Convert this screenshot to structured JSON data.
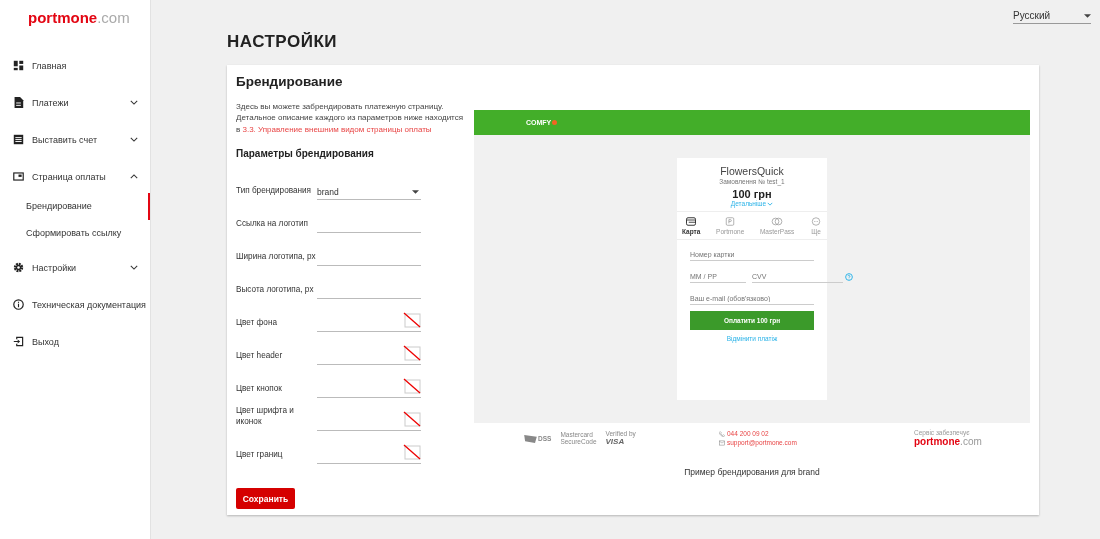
{
  "logo": {
    "brand": "portmone",
    "suffix": ".com"
  },
  "sidebar": {
    "items": [
      {
        "kind": "dashboard",
        "label": "Главная"
      },
      {
        "kind": "document",
        "label": "Платежи",
        "expanded": false
      },
      {
        "kind": "list",
        "label": "Выставить счет",
        "expanded": false
      },
      {
        "kind": "window",
        "label": "Страница оплаты",
        "expanded": true,
        "children": [
          {
            "label": "Брендирование",
            "selected": true
          },
          {
            "label": "Сформировать ссылку",
            "selected": false
          }
        ]
      },
      {
        "kind": "gear",
        "label": "Настройки",
        "expanded": false
      },
      {
        "kind": "info",
        "label": "Техническая документация"
      },
      {
        "kind": "exit",
        "label": "Выход"
      }
    ]
  },
  "language": "Русский",
  "page_title": "НАСТРОЙКИ",
  "card": {
    "title": "Брендирование",
    "intro": "Здесь вы можете забрендировать платежную страницу. Детальное описание каждого из параметров ниже находится в",
    "doc_link": "3.3. Управление внешним видом страницы оплаты",
    "params_title": "Параметры брендирования",
    "fields": [
      {
        "kind": "select",
        "label": "Тип брендирования",
        "value": "brand"
      },
      {
        "kind": "text",
        "label": "Ссылка на логотип"
      },
      {
        "kind": "text",
        "label": "Ширина логотипа, px"
      },
      {
        "kind": "text",
        "label": "Высота логотипа, px"
      },
      {
        "kind": "color",
        "label": "Цвет фона"
      },
      {
        "kind": "color",
        "label": "Цвет header"
      },
      {
        "kind": "color",
        "label": "Цвет кнопок"
      },
      {
        "kind": "color",
        "label": "Цвет шрифта и иконок"
      },
      {
        "kind": "color",
        "label": "Цвет границ"
      }
    ],
    "save_button": "Сохранить"
  },
  "preview": {
    "header_logo": "COMFY",
    "merchant": "FlowersQuick",
    "order": "Замовлення № test_1",
    "amount": "100 грн",
    "details": "Детальніше",
    "tabs": [
      {
        "kind": "card",
        "label": "Карта",
        "selected": true
      },
      {
        "kind": "p",
        "label": "Portmone",
        "selected": false
      },
      {
        "kind": "circles",
        "label": "MasterPass",
        "selected": false
      },
      {
        "kind": "dots",
        "label": "Ще",
        "selected": false
      }
    ],
    "card_placeholder": "Номер картки",
    "expiry_placeholder": "ММ / РР",
    "cvv_placeholder": "CVV",
    "email_placeholder": "Ваш e-mail (обов'язково)",
    "pay_button": "Оплатити 100 грн",
    "cancel_link": "Відмінити платіж",
    "footer": {
      "pci": "DSS",
      "mastercard": [
        "Mastercard",
        "SecureCode"
      ],
      "visa": [
        "Verified by",
        "VISA"
      ],
      "phone": "044 200 09 02",
      "email": "support@portmone.com",
      "service_label": "Сервіс забезпечує",
      "logo": {
        "brand": "portmone",
        "suffix": ".com"
      }
    }
  },
  "caption": "Пример брендирования для brand"
}
